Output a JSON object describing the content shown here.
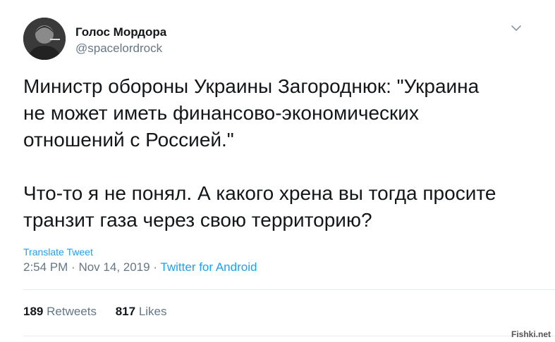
{
  "author": {
    "name": "Голос Мордора",
    "handle": "@spacelordrock"
  },
  "tweet": {
    "paragraphs": [
      "Министр обороны Украины Загороднюк: \"Украина\nне может иметь финансово-экономических\nотношений с Россией.\"",
      "Что-то я не понял. А какого хрена вы тогда просите\nтранзит газа через свою территорию?"
    ],
    "translate_label": "Translate Tweet",
    "time": "2:54 PM",
    "date": "Nov 14, 2019",
    "separator": "·",
    "source": "Twitter for Android"
  },
  "stats": {
    "retweets_count": "189",
    "retweets_label": "Retweets",
    "likes_count": "817",
    "likes_label": "Likes"
  },
  "watermark": "Fishki.net",
  "colors": {
    "link": "#1da1f2",
    "secondary": "#657786",
    "text": "#14171a"
  },
  "icons": {
    "caret": "chevron-down-icon",
    "avatar": "avatar"
  }
}
